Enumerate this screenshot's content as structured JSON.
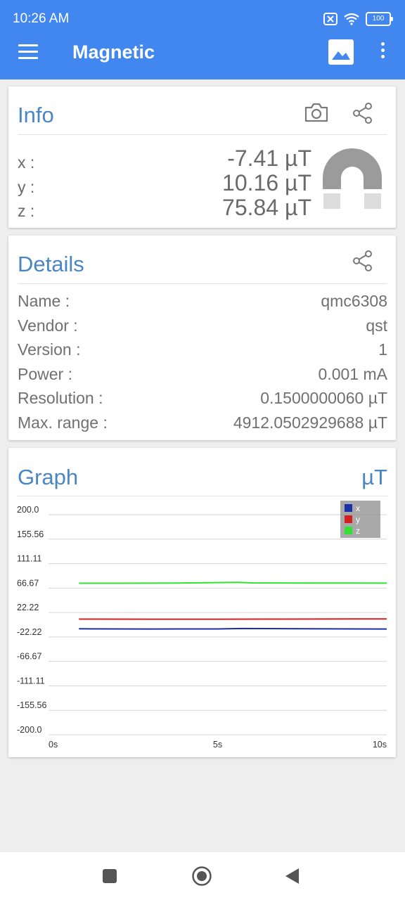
{
  "status_bar": {
    "time": "10:26 AM",
    "battery": "100"
  },
  "app_bar": {
    "title": "Magnetic",
    "icons": [
      "menu-icon",
      "image-icon",
      "more-vert-icon"
    ]
  },
  "info": {
    "title": "Info",
    "icons": [
      "camera-icon",
      "share-icon",
      "magnet-icon"
    ],
    "rows": [
      {
        "label": "x :",
        "value": "-7.41 µT"
      },
      {
        "label": "y :",
        "value": "10.16 µT"
      },
      {
        "label": "z :",
        "value": "75.84 µT"
      }
    ]
  },
  "details": {
    "title": "Details",
    "rows": [
      {
        "label": "Name :",
        "value": "qmc6308"
      },
      {
        "label": "Vendor :",
        "value": "qst"
      },
      {
        "label": "Version :",
        "value": "1"
      },
      {
        "label": "Power :",
        "value": "0.001 mA"
      },
      {
        "label": "Resolution :",
        "value": "0.1500000060 µT"
      },
      {
        "label": "Max. range :",
        "value": "4912.0502929688 µT"
      }
    ]
  },
  "graph": {
    "title": "Graph",
    "unit": "µT",
    "colors": {
      "x": "#1a2fa8",
      "y": "#d42020",
      "z": "#33e133",
      "grid": "#d6d6d6"
    }
  },
  "chart_data": {
    "type": "line",
    "ylim": [
      -200.0,
      200.0
    ],
    "y_ticks": [
      "200.0",
      "155.56",
      "111.11",
      "66.67",
      "22.22",
      "-22.22",
      "-66.67",
      "-111.11",
      "-155.56",
      "-200.0"
    ],
    "x_ticks": [
      "0s",
      "5s",
      "10s"
    ],
    "xlim": [
      0,
      10
    ],
    "legend": "top-right",
    "series": [
      {
        "name": "x",
        "x": [
          0.9,
          3,
          5,
          5.7,
          7,
          10
        ],
        "values": [
          -7.4,
          -7.8,
          -7.6,
          -6.8,
          -7.2,
          -7.9
        ]
      },
      {
        "name": "y",
        "x": [
          0.9,
          3,
          5,
          7,
          9,
          10
        ],
        "values": [
          10.2,
          10.1,
          10.0,
          10.2,
          10.5,
          10.6
        ]
      },
      {
        "name": "z",
        "x": [
          0.9,
          2,
          4,
          5.6,
          6,
          8,
          10
        ],
        "values": [
          75.4,
          75.4,
          75.8,
          77.0,
          76.0,
          75.7,
          75.6
        ]
      }
    ]
  },
  "nav_bar": {
    "icons": [
      "square-icon",
      "circle-home-icon",
      "back-triangle-icon"
    ]
  }
}
